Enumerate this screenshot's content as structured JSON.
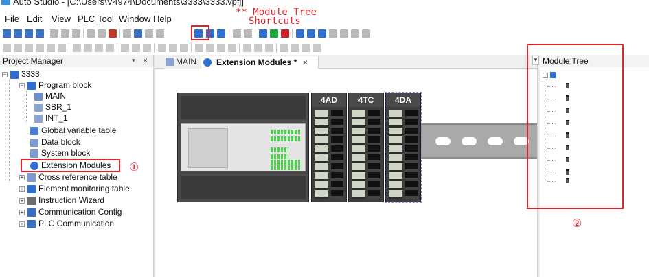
{
  "window": {
    "title": "Auto Studio - [C:\\Users\\V4974\\Documents\\3333\\3333.vpfj]"
  },
  "menu": {
    "items": [
      {
        "label": "File",
        "ul": "F",
        "rest": "ile"
      },
      {
        "label": "Edit",
        "ul": "E",
        "rest": "dit"
      },
      {
        "label": "View",
        "ul": "V",
        "rest": "iew"
      },
      {
        "label": "PLC",
        "ul": "P",
        "rest": "LC"
      },
      {
        "label": "Tool",
        "ul": "T",
        "rest": "ool"
      },
      {
        "label": "Window",
        "ul": "W",
        "rest": "indow"
      },
      {
        "label": "Help",
        "ul": "H",
        "rest": "elp"
      }
    ]
  },
  "annotations": {
    "shortcut_line1": "** Module Tree",
    "shortcut_line2": "Shortcuts",
    "marker1": "①",
    "marker2": "②"
  },
  "project_manager": {
    "title": "Project Manager",
    "pin": "▾",
    "close": "×",
    "tree": {
      "root": "3333",
      "program_block": "Program block",
      "main": "MAIN",
      "sbr": "SBR_1",
      "int": "INT_1",
      "global_vars": "Global variable table",
      "data_block": "Data block",
      "system_block": "System block",
      "extension_modules": "Extension Modules",
      "cross_ref": "Cross reference table",
      "element_monitoring": "Element monitoring table",
      "instruction_wizard": "Instruction Wizard",
      "comm_config": "Communication Config",
      "plc_comm": "PLC Communication"
    }
  },
  "tabs": {
    "main_label": "MAIN",
    "ext_label": "Extension Modules *",
    "close": "×"
  },
  "modules": [
    "4AD",
    "4TC",
    "4DA"
  ],
  "module_tree": {
    "title": "Module Tree"
  },
  "colors": {
    "annotation_red": "#e0242b",
    "accent_blue": "#2f6fd0"
  }
}
